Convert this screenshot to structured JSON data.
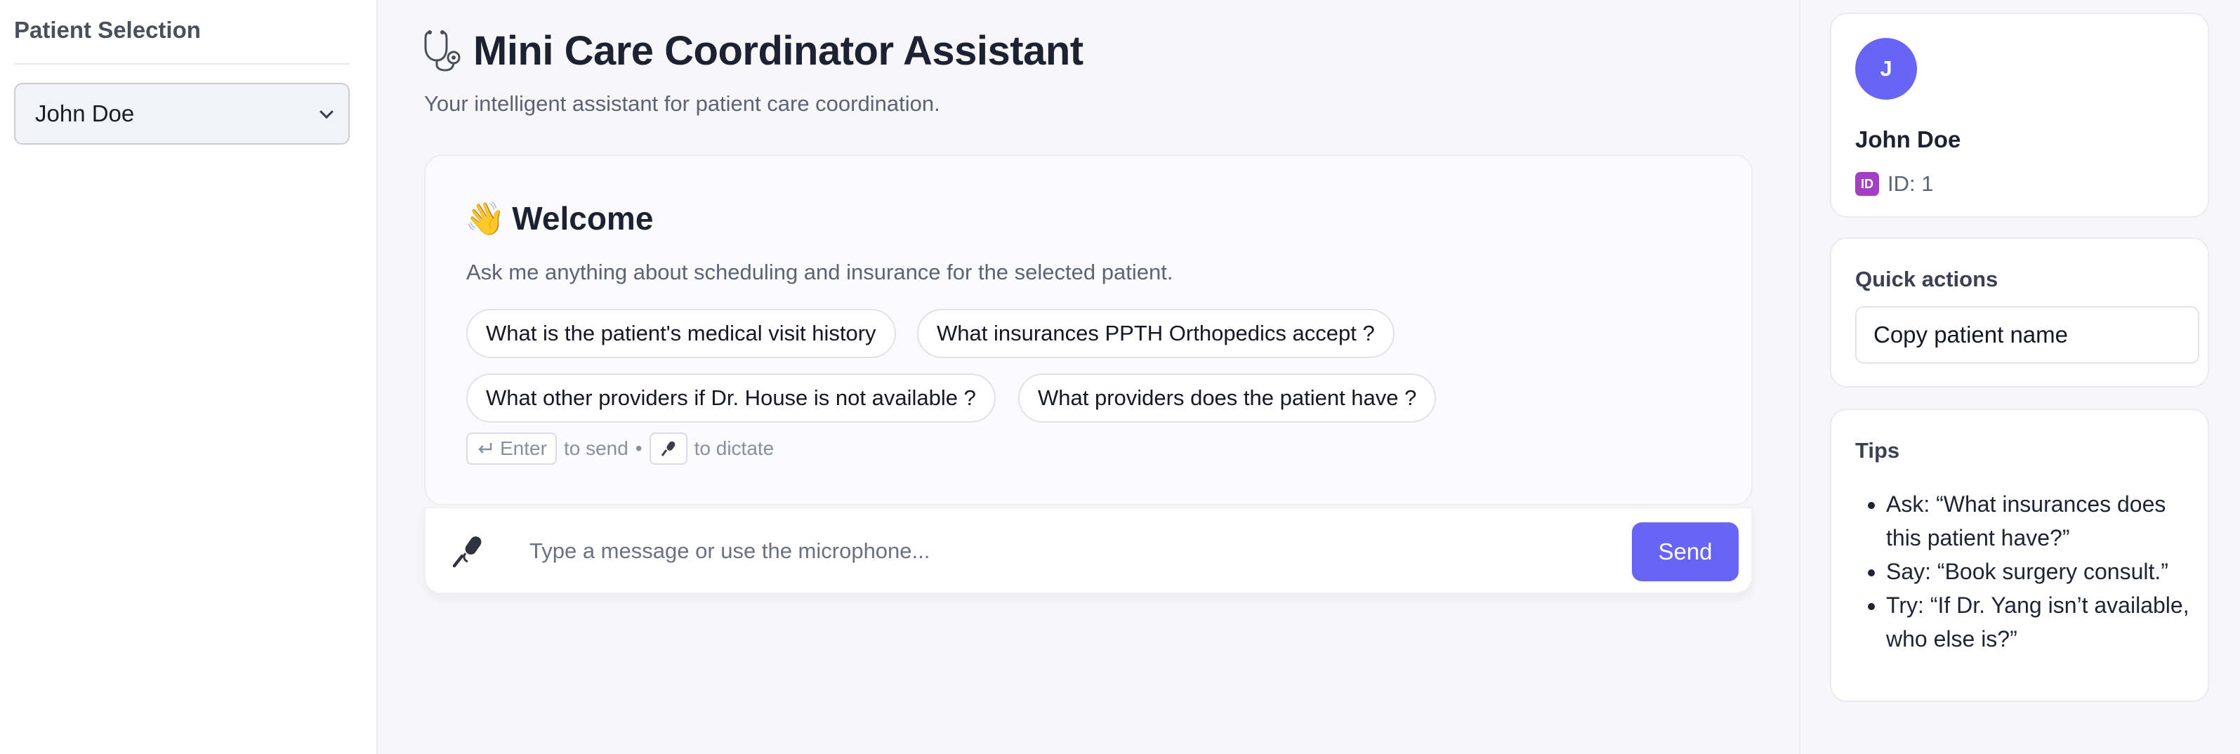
{
  "sidebar": {
    "title": "Patient Selection",
    "selected_patient": "John Doe"
  },
  "header": {
    "title": "Mini Care Coordinator Assistant",
    "subtitle": "Your intelligent assistant for patient care coordination."
  },
  "welcome": {
    "emoji": "👋",
    "title": "Welcome",
    "text": "Ask me anything about scheduling and insurance for the selected patient.",
    "suggestions": [
      "What is the patient's medical visit history",
      "What insurances PPTH Orthopedics accept ?",
      "What other providers if Dr. House is not available ?",
      "What providers does the patient have ?"
    ],
    "hint": {
      "enter_key": "Enter",
      "send_text": "to send",
      "separator": "•",
      "dictate_text": "to dictate"
    }
  },
  "composer": {
    "placeholder": "Type a message or use the microphone...",
    "send_label": "Send"
  },
  "profile": {
    "initial": "J",
    "name": "John Doe",
    "id_badge": "ID",
    "id_text": "ID: 1"
  },
  "quick_actions": {
    "title": "Quick actions",
    "items": [
      "Copy patient name"
    ]
  },
  "tips": {
    "title": "Tips",
    "items": [
      "Ask: “What insurances does this patient have?”",
      "Say: “Book surgery consult.”",
      "Try: “If Dr. Yang isn’t available, who else is?”"
    ]
  },
  "colors": {
    "accent": "#6864f5",
    "id_badge": "#a23fc4",
    "background": "#f7f7fa"
  },
  "icons": {
    "title": "stethoscope-icon",
    "microphone": "microphone-icon",
    "enter": "enter-key-icon",
    "select": "chevron-down-icon"
  }
}
